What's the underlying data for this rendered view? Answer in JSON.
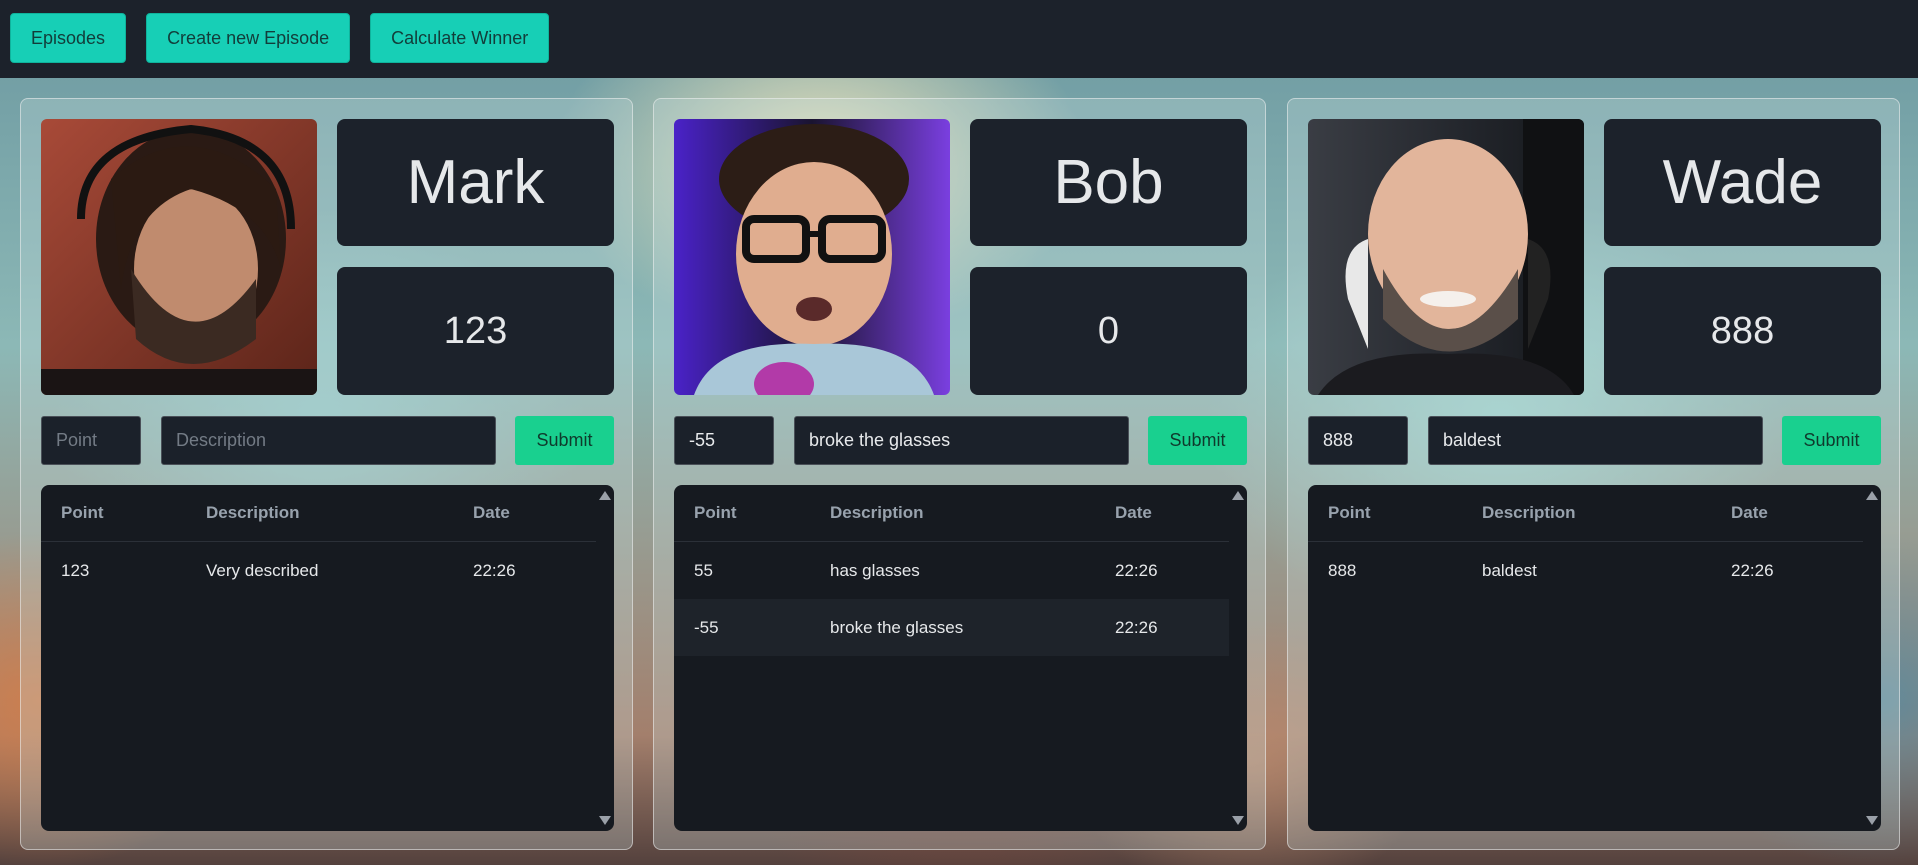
{
  "nav": {
    "episodes": "Episodes",
    "create_episode": "Create new Episode",
    "calculate_winner": "Calculate Winner"
  },
  "players": [
    {
      "name": "Mark",
      "score": "123",
      "photo_icon": "avatar-photo",
      "form": {
        "point_value": "",
        "point_placeholder": "Point",
        "description_value": "",
        "description_placeholder": "Description",
        "submit_label": "Submit"
      },
      "table": {
        "headers": [
          "Point",
          "Description",
          "Date"
        ],
        "rows": [
          [
            "123",
            "Very described",
            "22:26"
          ]
        ]
      }
    },
    {
      "name": "Bob",
      "score": "0",
      "photo_icon": "avatar-photo",
      "form": {
        "point_value": "-55",
        "point_placeholder": "Point",
        "description_value": "broke the glasses",
        "description_placeholder": "Description",
        "submit_label": "Submit"
      },
      "table": {
        "headers": [
          "Point",
          "Description",
          "Date"
        ],
        "rows": [
          [
            "55",
            "has glasses",
            "22:26"
          ],
          [
            "-55",
            "broke the glasses",
            "22:26"
          ]
        ]
      }
    },
    {
      "name": "Wade",
      "score": "888",
      "photo_icon": "avatar-photo",
      "form": {
        "point_value": "888",
        "point_placeholder": "Point",
        "description_value": "baldest",
        "description_placeholder": "Description",
        "submit_label": "Submit"
      },
      "table": {
        "headers": [
          "Point",
          "Description",
          "Date"
        ],
        "rows": [
          [
            "888",
            "baldest",
            "22:26"
          ]
        ]
      }
    }
  ],
  "colors": {
    "topbar": "#1c222b",
    "nav_button": "#17cfb6",
    "submit_button": "#19d08f",
    "card": "#1c222b",
    "table_bg": "#161a20"
  }
}
